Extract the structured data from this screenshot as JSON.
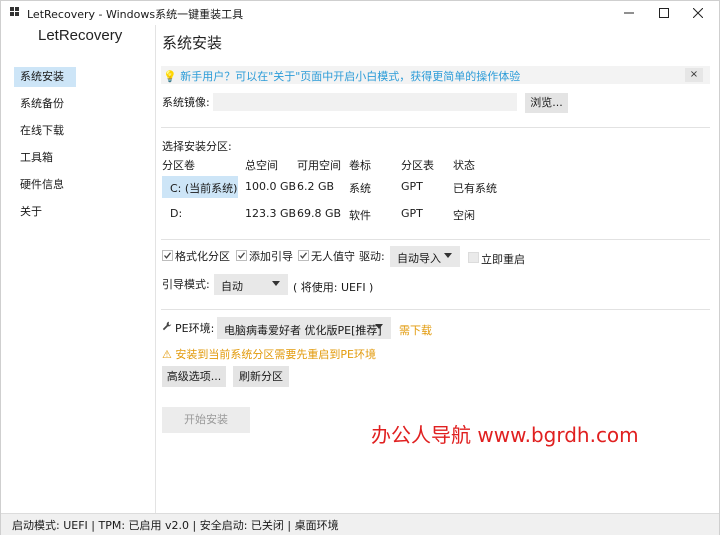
{
  "window": {
    "title": "LetRecovery - Windows系统一键重装工具",
    "minimize_icon": "minimize-icon",
    "maximize_icon": "maximize-icon",
    "close_icon": "close-icon"
  },
  "sidebar": {
    "brand": "LetRecovery",
    "items": [
      {
        "label": "系统安装",
        "active": true
      },
      {
        "label": "系统备份",
        "active": false
      },
      {
        "label": "在线下载",
        "active": false
      },
      {
        "label": "工具箱",
        "active": false
      },
      {
        "label": "硬件信息",
        "active": false
      },
      {
        "label": "关于",
        "active": false
      }
    ]
  },
  "main": {
    "title": "系统安装",
    "notice": {
      "text": "💡 新手用户？可以在\"关于\"页面中开启小白模式，获得更简单的操作体验",
      "close": "×"
    },
    "image_label": "系统镜像:",
    "image_value": "",
    "browse_button": "浏览...",
    "partition_section_label": "选择安装分区:",
    "partition_table": {
      "headers": [
        "分区卷",
        "总空间",
        "可用空间",
        "卷标",
        "分区表",
        "状态"
      ],
      "rows": [
        [
          "C: (当前系统)",
          "100.0 GB",
          "6.2 GB",
          "系统",
          "GPT",
          "已有系统"
        ],
        [
          "D:",
          "123.3 GB",
          "69.8 GB",
          "软件",
          "GPT",
          "空闲"
        ]
      ],
      "selected_row": 0
    },
    "options": {
      "format_label": "格式化分区",
      "format_checked": true,
      "add_boot_label": "添加引导",
      "add_boot_checked": true,
      "unattended_label": "无人值守",
      "unattended_checked": true,
      "driver_label": "驱动:",
      "driver_value": "自动导入",
      "reboot_label": "立即重启",
      "reboot_checked": false
    },
    "boot_mode_label": "引导模式:",
    "boot_mode_value": "自动",
    "boot_mode_note": "( 将使用: UEFI )",
    "pe": {
      "label": "PE环境:",
      "value": "电脑病毒爱好者 优化版PE[推荐]",
      "download_link": "需下载",
      "warning": "⚠ 安装到当前系统分区需要先重启到PE环境"
    },
    "advanced_button": "高级选项...",
    "refresh_button": "刷新分区",
    "start_button": "开始安装",
    "watermark": "办公人导航  www.bgrdh.com"
  },
  "statusbar": {
    "text": "启动模式: UEFI | TPM: 已启用 v2.0 | 安全启动: 已关闭 | 桌面环境"
  },
  "colors": {
    "accent": "#cde5f7",
    "link": "#2c9cd8",
    "warning": "#e29a0b",
    "watermark": "#e02020"
  }
}
